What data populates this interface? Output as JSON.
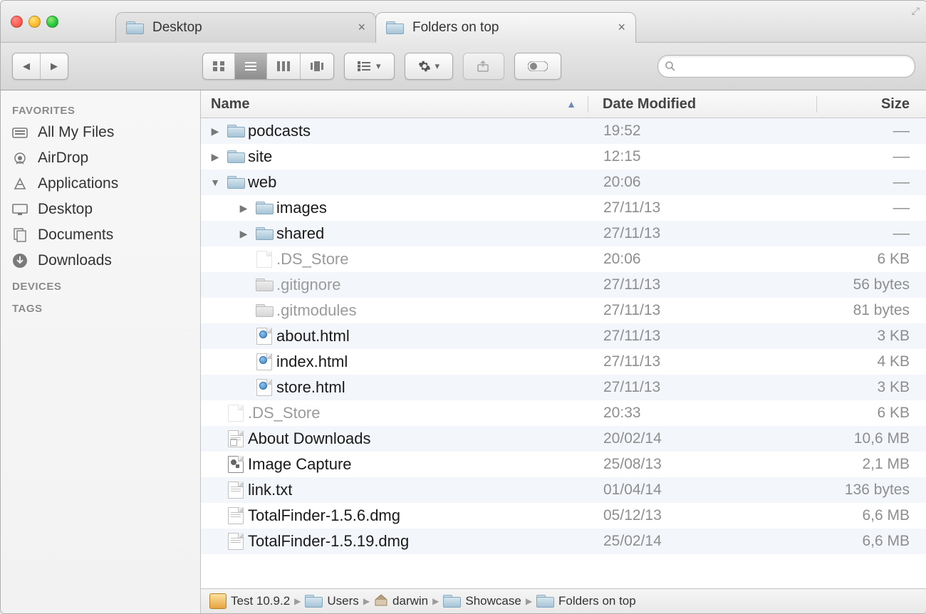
{
  "tabs": [
    {
      "label": "Desktop",
      "active": false
    },
    {
      "label": "Folders on top",
      "active": true
    }
  ],
  "sidebar": {
    "sections": [
      {
        "title": "FAVORITES",
        "items": [
          {
            "icon": "all-my-files-icon",
            "label": "All My Files"
          },
          {
            "icon": "airdrop-icon",
            "label": "AirDrop"
          },
          {
            "icon": "applications-icon",
            "label": "Applications"
          },
          {
            "icon": "desktop-icon",
            "label": "Desktop"
          },
          {
            "icon": "documents-icon",
            "label": "Documents"
          },
          {
            "icon": "downloads-icon",
            "label": "Downloads"
          }
        ]
      },
      {
        "title": "DEVICES",
        "items": []
      },
      {
        "title": "TAGS",
        "items": []
      }
    ]
  },
  "columns": {
    "name": "Name",
    "date": "Date Modified",
    "size": "Size",
    "sort": "name",
    "dir": "asc"
  },
  "rows": [
    {
      "indent": 0,
      "disc": "closed",
      "icon": "folder",
      "name": "podcasts",
      "date": "19:52",
      "size": "––",
      "dim": false
    },
    {
      "indent": 0,
      "disc": "closed",
      "icon": "folder",
      "name": "site",
      "date": "12:15",
      "size": "––",
      "dim": false
    },
    {
      "indent": 0,
      "disc": "open",
      "icon": "folder",
      "name": "web",
      "date": "20:06",
      "size": "––",
      "dim": false
    },
    {
      "indent": 1,
      "disc": "closed",
      "icon": "folder",
      "name": "images",
      "date": "27/11/13",
      "size": "––",
      "dim": false
    },
    {
      "indent": 1,
      "disc": "closed",
      "icon": "folder",
      "name": "shared",
      "date": "27/11/13",
      "size": "––",
      "dim": false
    },
    {
      "indent": 1,
      "disc": "none",
      "icon": "file-dim",
      "name": ".DS_Store",
      "date": "20:06",
      "size": "6 KB",
      "dim": true
    },
    {
      "indent": 1,
      "disc": "none",
      "icon": "folder-dim",
      "name": ".gitignore",
      "date": "27/11/13",
      "size": "56 bytes",
      "dim": true
    },
    {
      "indent": 1,
      "disc": "none",
      "icon": "folder-dim",
      "name": ".gitmodules",
      "date": "27/11/13",
      "size": "81 bytes",
      "dim": true
    },
    {
      "indent": 1,
      "disc": "none",
      "icon": "html",
      "name": "about.html",
      "date": "27/11/13",
      "size": "3 KB",
      "dim": false
    },
    {
      "indent": 1,
      "disc": "none",
      "icon": "html",
      "name": "index.html",
      "date": "27/11/13",
      "size": "4 KB",
      "dim": false
    },
    {
      "indent": 1,
      "disc": "none",
      "icon": "html",
      "name": "store.html",
      "date": "27/11/13",
      "size": "3 KB",
      "dim": false
    },
    {
      "indent": 0,
      "disc": "none",
      "icon": "file-dim",
      "name": ".DS_Store",
      "date": "20:33",
      "size": "6 KB",
      "dim": true
    },
    {
      "indent": 0,
      "disc": "none",
      "icon": "loc",
      "name": "About Downloads",
      "date": "20/02/14",
      "size": "10,6 MB",
      "dim": false
    },
    {
      "indent": 0,
      "disc": "none",
      "icon": "app",
      "name": "Image Capture",
      "date": "25/08/13",
      "size": "2,1 MB",
      "dim": false
    },
    {
      "indent": 0,
      "disc": "none",
      "icon": "txt",
      "name": "link.txt",
      "date": "01/04/14",
      "size": "136 bytes",
      "dim": false
    },
    {
      "indent": 0,
      "disc": "none",
      "icon": "dmg",
      "name": "TotalFinder-1.5.6.dmg",
      "date": "05/12/13",
      "size": "6,6 MB",
      "dim": false
    },
    {
      "indent": 0,
      "disc": "none",
      "icon": "dmg",
      "name": "TotalFinder-1.5.19.dmg",
      "date": "25/02/14",
      "size": "6,6 MB",
      "dim": false
    }
  ],
  "path": [
    {
      "icon": "disk",
      "label": "Test 10.9.2"
    },
    {
      "icon": "folder",
      "label": "Users"
    },
    {
      "icon": "home",
      "label": "darwin"
    },
    {
      "icon": "folder",
      "label": "Showcase"
    },
    {
      "icon": "folder",
      "label": "Folders on top"
    }
  ],
  "search": {
    "placeholder": ""
  }
}
